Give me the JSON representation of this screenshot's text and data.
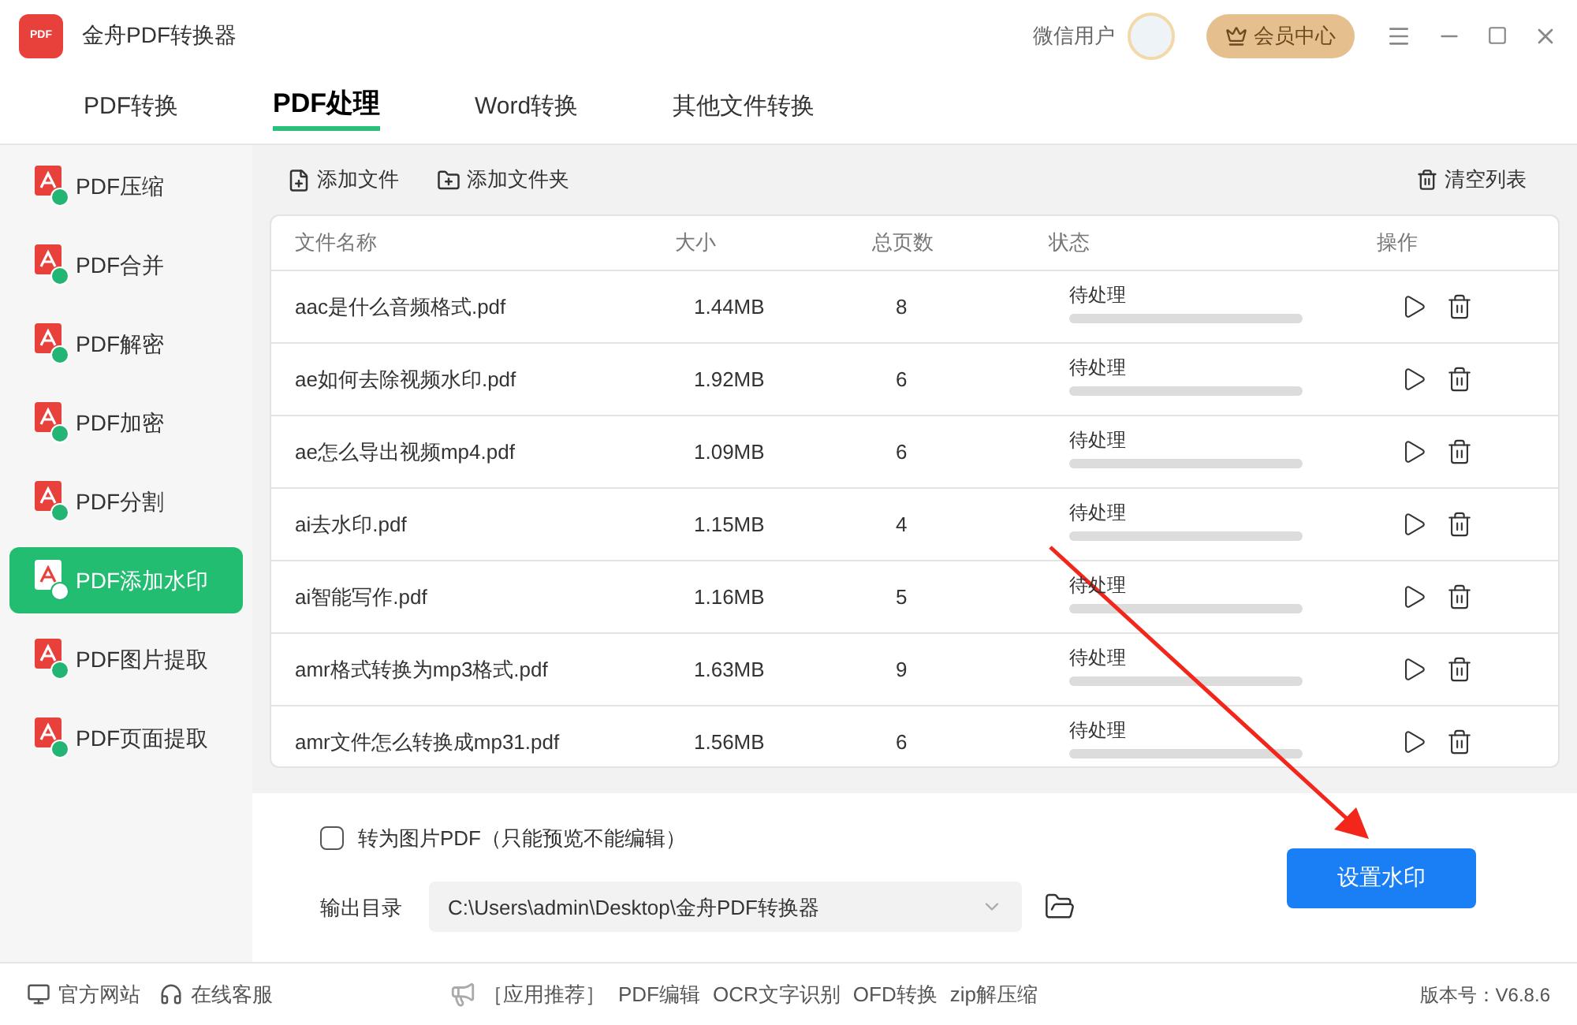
{
  "app": {
    "logo_text": "PDF",
    "title": "金舟PDF转换器",
    "user": "微信用户",
    "vip_button": "会员中心"
  },
  "tabs": [
    {
      "label": "PDF转换",
      "selected": false
    },
    {
      "label": "PDF处理",
      "selected": true
    },
    {
      "label": "Word转换",
      "selected": false
    },
    {
      "label": "其他文件转换",
      "selected": false
    }
  ],
  "sidebar": {
    "items": [
      {
        "label": "PDF压缩",
        "selected": false
      },
      {
        "label": "PDF合并",
        "selected": false
      },
      {
        "label": "PDF解密",
        "selected": false
      },
      {
        "label": "PDF加密",
        "selected": false
      },
      {
        "label": "PDF分割",
        "selected": false
      },
      {
        "label": "PDF添加水印",
        "selected": true
      },
      {
        "label": "PDF图片提取",
        "selected": false
      },
      {
        "label": "PDF页面提取",
        "selected": false
      }
    ]
  },
  "toolbar": {
    "add_file": "添加文件",
    "add_folder": "添加文件夹",
    "clear": "清空列表"
  },
  "table": {
    "columns": [
      "文件名称",
      "大小",
      "总页数",
      "状态",
      "操作"
    ],
    "rows": [
      {
        "name": "aac是什么音频格式.pdf",
        "size": "1.44MB",
        "pages": "8",
        "status": "待处理",
        "level": 0
      },
      {
        "name": "ae如何去除视频水印.pdf",
        "size": "1.92MB",
        "pages": "6",
        "status": "待处理",
        "level": 0
      },
      {
        "name": "ae怎么导出视频mp4.pdf",
        "size": "1.09MB",
        "pages": "6",
        "status": "待处理",
        "level": 0
      },
      {
        "name": "ai去水印.pdf",
        "size": "1.15MB",
        "pages": "4",
        "status": "待处理",
        "level": 0
      },
      {
        "name": "ai智能写作.pdf",
        "size": "1.16MB",
        "pages": "5",
        "status": "待处理",
        "level": 0
      },
      {
        "name": "amr格式转换为mp3格式.pdf",
        "size": "1.63MB",
        "pages": "9",
        "status": "待处理",
        "level": 0
      },
      {
        "name": "amr文件怎么转换成mp31.pdf",
        "size": "1.56MB",
        "pages": "6",
        "status": "待处理",
        "level": 0
      }
    ]
  },
  "options": {
    "to_image_label": "转为图片PDF（只能预览不能编辑）",
    "to_image_checked": false,
    "output_label": "输出目录",
    "output_path": "C:\\Users\\admin\\Desktop\\金舟PDF转换器",
    "action_button": "设置水印"
  },
  "status_bar": {
    "left": [
      "官方网站",
      "在线客服"
    ],
    "promo": [
      "［应用推荐］",
      "PDF编辑",
      "OCR文字识别",
      "OFD转换",
      "zip解压缩"
    ],
    "version": "版本号：V6.8.6"
  }
}
